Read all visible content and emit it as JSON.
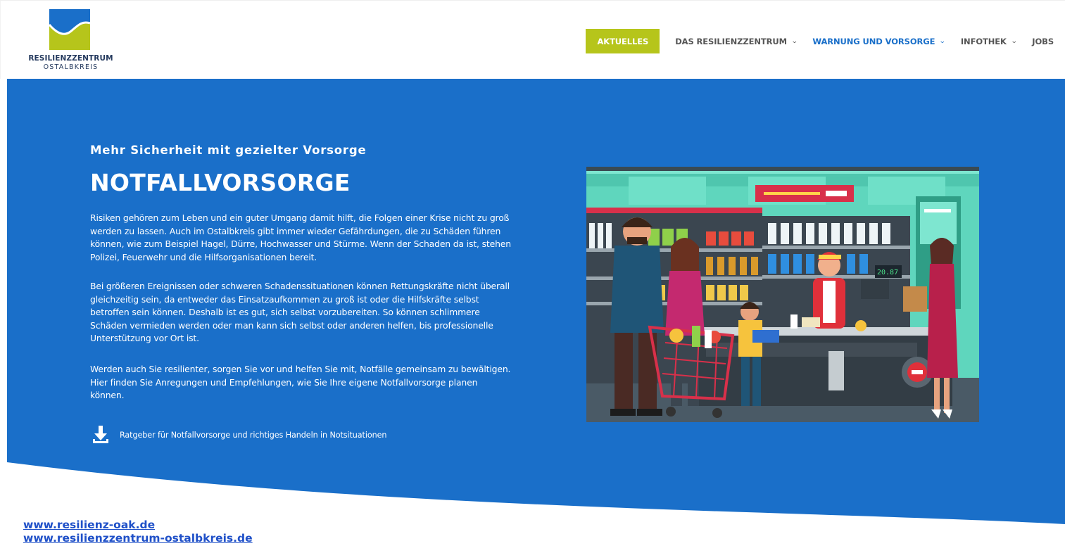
{
  "brand": {
    "name": "RESILIENZZENTRUM",
    "subname": "OSTALBKREIS",
    "colors": {
      "green": "#b6c51b",
      "blue": "#1a6fc9",
      "navy": "#253a5e"
    }
  },
  "nav": {
    "items": [
      {
        "label": "AKTUELLES",
        "chevron": false
      },
      {
        "label": "DAS RESILIENZZENTRUM",
        "chevron": true
      },
      {
        "label": "WARNUNG UND VORSORGE",
        "chevron": true
      },
      {
        "label": "INFOTHEK",
        "chevron": true
      },
      {
        "label": "JOBS",
        "chevron": false
      }
    ],
    "chevron_glyph": "⌄"
  },
  "hero": {
    "subtitle": "Mehr Sicherheit mit gezielter Vorsorge",
    "title": "NOTFALLVORSORGE",
    "paragraphs": [
      "Risiken gehören zum Leben und ein guter Umgang damit hilft, die Folgen einer Krise nicht zu groß werden zu lassen. Auch im Ostalbkreis gibt immer wieder Gefährdungen, die zu Schäden führen können, wie zum Beispiel Hagel, Dürre, Hochwasser und Stürme. Wenn der Schaden da ist, stehen Polizei, Feuerwehr und die Hilfsorganisationen bereit.",
      "Bei größeren Ereignissen oder schweren Schadenssituationen können Rettungskräfte nicht überall gleichzeitig sein, da entweder das Einsatzaufkommen zu groß ist oder die Hilfskräfte selbst betroffen sein können. Deshalb ist es gut, sich selbst vorzubereiten. So können schlimmere Schäden vermieden werden oder man kann sich selbst oder anderen helfen, bis professionelle Unterstützung vor Ort ist.",
      "Werden auch Sie resilienter, sorgen Sie vor und helfen Sie mit, Notfälle gemeinsam zu bewältigen. Hier finden Sie Anregungen und Empfehlungen, wie Sie Ihre eigene Notfallvorsorge planen können."
    ],
    "download": {
      "label": "Ratgeber für Notfallvorsorge und richtiges Handeln in Notsituationen",
      "icon": "download-icon"
    },
    "illustration": {
      "register_display": "20.87"
    }
  },
  "footer_links": [
    "www.resilienz-oak.de",
    "www.resilienzzentrum-ostalbkreis.de"
  ]
}
